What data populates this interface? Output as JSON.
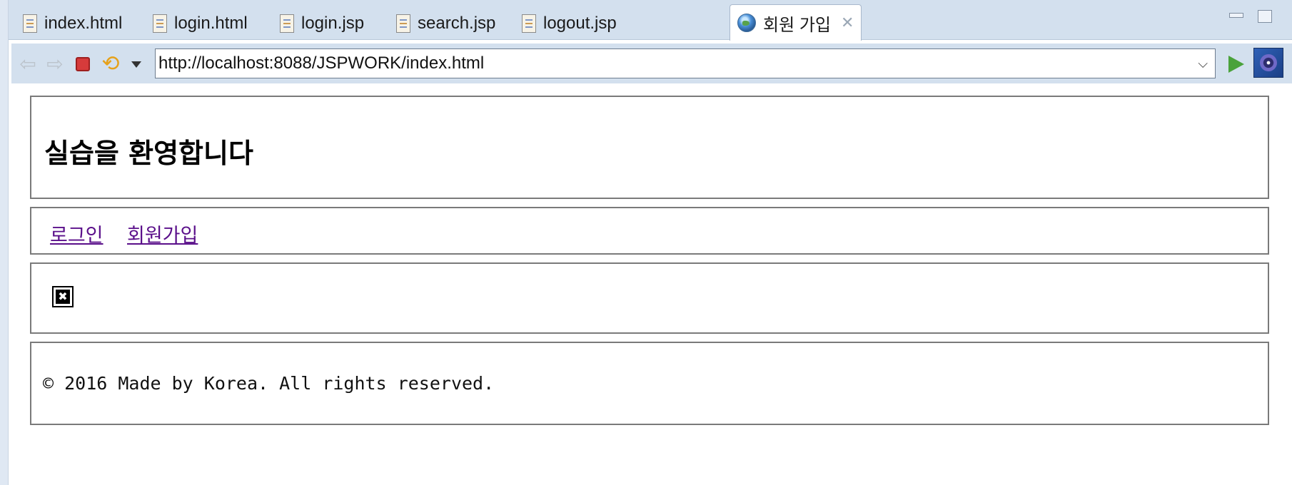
{
  "tabs": [
    {
      "label": "index.html",
      "icon": "file-icon"
    },
    {
      "label": "login.html",
      "icon": "file-icon"
    },
    {
      "label": "login.jsp",
      "icon": "file-icon"
    },
    {
      "label": "search.jsp",
      "icon": "file-icon"
    },
    {
      "label": "logout.jsp",
      "icon": "file-icon"
    },
    {
      "label": "회원 가입",
      "icon": "globe-icon",
      "active": true,
      "close_symbol": "✕"
    }
  ],
  "toolbar": {
    "url": "http://localhost:8088/JSPWORK/index.html",
    "url_chevron": "⌵"
  },
  "page": {
    "heading": "실습을 환영합니다",
    "nav": {
      "login": "로그인",
      "join": "회원가입"
    },
    "broken_image_symbol": "✖",
    "footer": "© 2016 Made by Korea. All rights reserved."
  },
  "colors": {
    "chrome": "#d3e0ee",
    "visited_link": "#5a0f8a",
    "border": "#7a7a7a"
  }
}
